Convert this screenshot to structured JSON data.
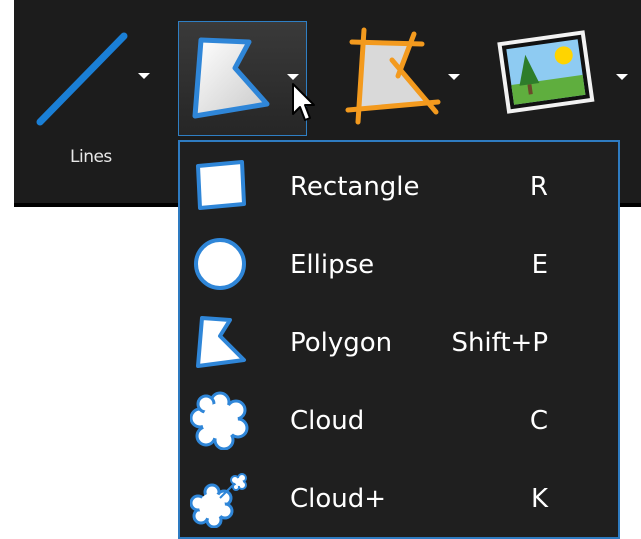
{
  "toolbar": {
    "lines_label": "Lines",
    "tools": [
      {
        "icon": "line-icon",
        "has_dropdown": true
      },
      {
        "icon": "polygon-icon",
        "has_dropdown": true,
        "active": true
      },
      {
        "icon": "crop-polygon-icon",
        "has_dropdown": true
      },
      {
        "icon": "image-icon",
        "has_dropdown": true
      }
    ]
  },
  "menu": {
    "items": [
      {
        "label": "Rectangle",
        "shortcut": "R",
        "icon": "rectangle-icon"
      },
      {
        "label": "Ellipse",
        "shortcut": "E",
        "icon": "ellipse-icon"
      },
      {
        "label": "Polygon",
        "shortcut": "Shift+P",
        "icon": "polygon-icon"
      },
      {
        "label": "Cloud",
        "shortcut": "C",
        "icon": "cloud-icon"
      },
      {
        "label": "Cloud+",
        "shortcut": "K",
        "icon": "cloud-plus-icon"
      }
    ]
  },
  "colors": {
    "toolbar_bg": "#1c1c1c",
    "menu_bg": "#1f1f1f",
    "accent_blue": "#2e7bc1",
    "crop_orange": "#f39a1e"
  }
}
